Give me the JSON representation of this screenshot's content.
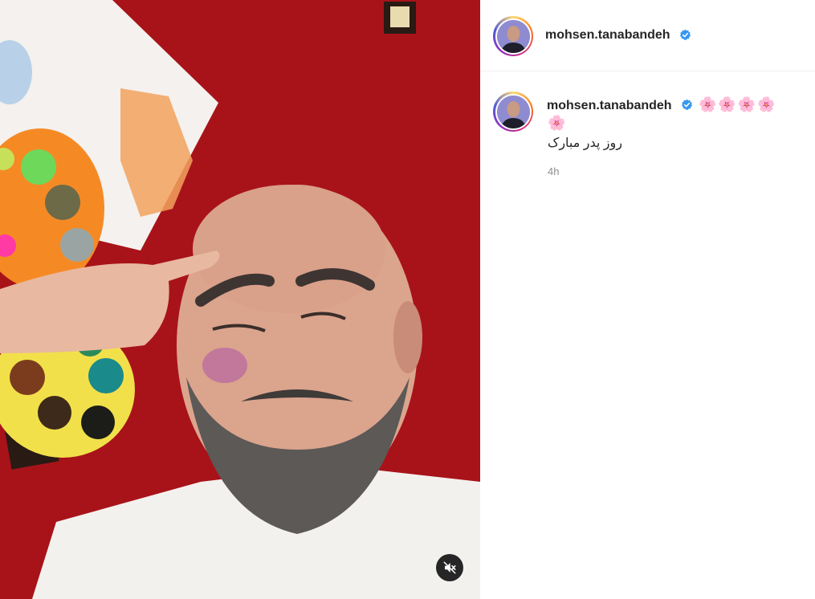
{
  "post": {
    "username": "mohsen.tanabandeh",
    "caption_emoji_line1": "🌸🌸🌸🌸",
    "caption_emoji_line2": "🌸",
    "caption_text": "روز پدر مبارک",
    "timestamp": "4h"
  },
  "icons": {
    "verified": "verified-badge-icon",
    "mute": "speaker-muted-icon"
  },
  "colors": {
    "verified_blue": "#3897f0",
    "rug_red": "#b0141c",
    "divider": "#efefef",
    "timestamp_gray": "#8e8e8e"
  }
}
